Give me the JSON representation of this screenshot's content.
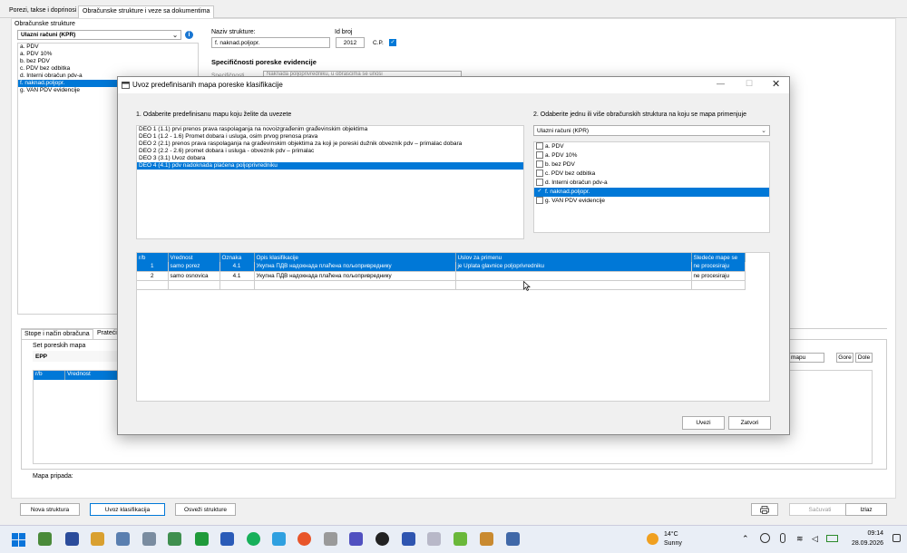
{
  "tabs": [
    "Porezi, takse i doprinosi",
    "Obračunske strukture i veze sa dokumentima"
  ],
  "left": {
    "group_label": "Obračunske strukture",
    "combo_value": "Ulazni računi (KPR)",
    "items": [
      "a. PDV",
      "a. PDV 10%",
      "b. bez PDV",
      "c. PDV bez odbitka",
      "d. Interni obračun pdv-a",
      "f. naknad.poljopr.",
      "g. VAN PDV evidencije"
    ],
    "selected_index": 5
  },
  "right": {
    "naziv_label": "Naziv strukture:",
    "naziv_value": "f. naknad.poljopr.",
    "id_label": "Id broj",
    "id_value": "2012",
    "cp_label": "C.P.",
    "specific_title": "Specifičnosti poreske evidencije",
    "specific_label": "Specifičnosti",
    "specific_value": "Naknada poljoprivredniku, u obrascima se unosi"
  },
  "bottom": {
    "tabs": [
      "Stope i način obračuna",
      "Prateći"
    ],
    "set_label": "Set poreskih mapa",
    "set_value": "EPP",
    "grid_headers": [
      "r/b",
      "Vrednost"
    ],
    "right_buttons": [
      "mapu",
      "Gore",
      "Dole"
    ],
    "mapa_label": "Mapa pripada:"
  },
  "footer": {
    "buttons": [
      "Nova struktura",
      "Uvoz klasifikacija",
      "Osveži strukture"
    ],
    "right_buttons": [
      "Sačuvati",
      "Izlaz"
    ]
  },
  "dialog": {
    "title": "Uvoz predefinisanih mapa poreske klasifikacije",
    "step1": "1. Odaberite predefinisanu mapu koju želite da uvezete",
    "maps": [
      "DEO 1   (1.1) prvi prenos prava raspolaganja na novoizgrađenim građevinskim objektima",
      "DEO 1   (1.2 - 1.6) Promet dobara i usluga, osim prvog prenosa prava",
      "DEO 2   (2.1) prenos prava raspolaganja na građevinskim objektima za koji je poreski dužnik obveznik pdv – primalac dobara",
      "DEO 2   (2.2 - 2.6) promet dobara i usluga - obveznik pdv – primalac",
      "DEO 3   (3.1) Uvoz dobara",
      "DEO 4   (4.1) pdv nadoknada plaćena poljoprivredniku"
    ],
    "selected_map": 5,
    "step2": "2. Odaberite jednu ili više obračunskih struktura na koju se mapa primenjuje",
    "combo_value": "Ulazni računi (KPR)",
    "structures": [
      {
        "label": "a. PDV",
        "checked": false
      },
      {
        "label": "a. PDV 10%",
        "checked": false
      },
      {
        "label": "b. bez PDV",
        "checked": false
      },
      {
        "label": "c. PDV bez odbitka",
        "checked": false
      },
      {
        "label": "d. Interni obračun pdv-a",
        "checked": false
      },
      {
        "label": "f. naknad.poljopr.",
        "checked": true
      },
      {
        "label": "g. VAN PDV evidencije",
        "checked": false
      }
    ],
    "selected_structure": 5,
    "grid_headers": [
      "r/b",
      "Vrednost",
      "Oznaka",
      "Opis klasifikacije",
      "Uslov za primenu",
      "Sledeće mape se"
    ],
    "rows": [
      [
        "1",
        "samo porez",
        "4.1",
        "Укупна ПДВ надокнада плаћена пољопривреднику",
        "je Uplata glavnice poljoprivredniku",
        "ne procesiraju"
      ],
      [
        "2",
        "samo osnovica",
        "4.1",
        "Укупна ПДВ надокнада плаћена пољопривреднику",
        "",
        "ne procesiraju"
      ]
    ],
    "selected_row": 0,
    "buttons": [
      "Uvezi",
      "Zatvori"
    ]
  },
  "taskbar": {
    "weather_temp": "14°C",
    "weather_desc": "Sunny",
    "time": "09:14",
    "date": "28.09.2026"
  }
}
